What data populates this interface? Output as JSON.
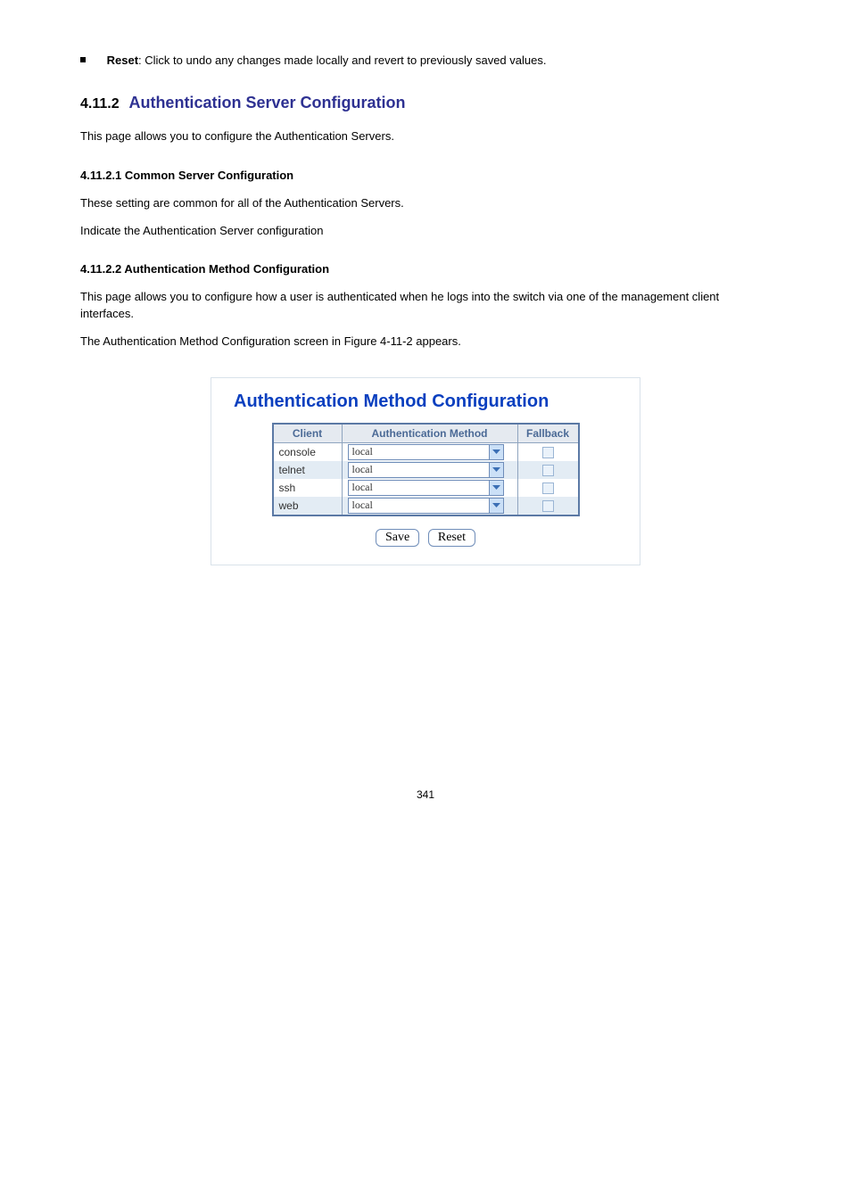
{
  "bullet_label": "Reset",
  "bullet_text": ": Click to undo any changes made locally and revert to previously saved values.",
  "section": {
    "number": "4.11.2",
    "title": "Authentication Server Configuration"
  },
  "paragraphs": {
    "p1": "This page allows you to configure the Authentication Servers.",
    "p2": "This page allows you to configure how a user is authenticated when he logs into the switch via one of the management client interfaces.",
    "p3": "The Authentication Method Configuration screen in Figure 4-11-2 appears."
  },
  "figure": {
    "panel_title": "Authentication Method Configuration",
    "headers": {
      "client": "Client",
      "method": "Authentication Method",
      "fallback": "Fallback"
    },
    "rows": [
      {
        "client": "console",
        "method": "local"
      },
      {
        "client": "telnet",
        "method": "local"
      },
      {
        "client": "ssh",
        "method": "local"
      },
      {
        "client": "web",
        "method": "local"
      }
    ],
    "buttons": {
      "save": "Save",
      "reset": "Reset"
    }
  },
  "footer_page": "341"
}
